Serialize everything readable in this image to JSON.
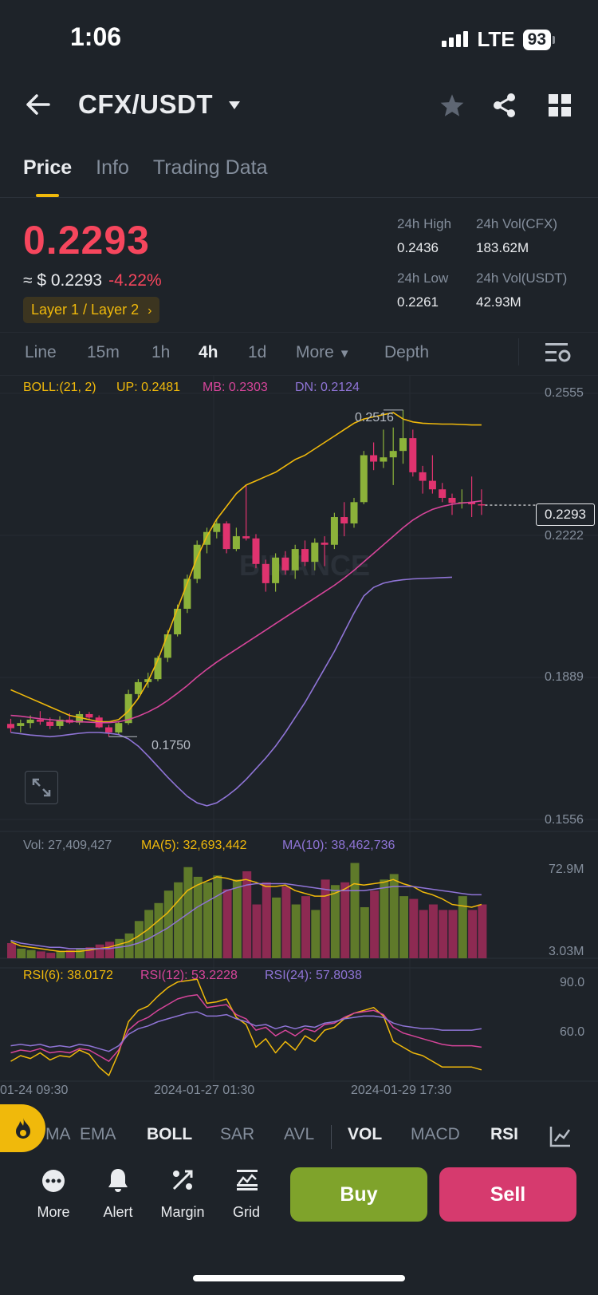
{
  "status_bar": {
    "time": "1:06",
    "network": "LTE",
    "battery": "93"
  },
  "header": {
    "pair": "CFX/USDT"
  },
  "tabs": [
    {
      "label": "Price",
      "active": true
    },
    {
      "label": "Info",
      "active": false
    },
    {
      "label": "Trading Data",
      "active": false
    }
  ],
  "price": {
    "last": "0.2293",
    "approx_usd": "≈ $ 0.2293",
    "change": "-4.22%",
    "tag": "Layer 1 / Layer 2"
  },
  "stats": {
    "high_label": "24h High",
    "high_value": "0.2436",
    "vol_cfx_label": "24h Vol(CFX)",
    "vol_cfx_value": "183.62M",
    "low_label": "24h Low",
    "low_value": "0.2261",
    "vol_usdt_label": "24h Vol(USDT)",
    "vol_usdt_value": "42.93M"
  },
  "intervals": [
    {
      "label": "Line"
    },
    {
      "label": "15m"
    },
    {
      "label": "1h"
    },
    {
      "label": "4h",
      "active": true
    },
    {
      "label": "1d"
    },
    {
      "label": "More"
    },
    {
      "label": "Depth"
    }
  ],
  "boll_legend": {
    "label": "BOLL:(21, 2)",
    "up": "UP: 0.2481",
    "mb": "MB: 0.2303",
    "dn": "DN: 0.2124"
  },
  "price_axis": [
    "0.2555",
    "0.2222",
    "0.1889",
    "0.1556"
  ],
  "current_price_tag": "0.2293",
  "high_marker": "0.2516",
  "low_marker": "0.1750",
  "watermark": "BINANCE",
  "vol_legend": {
    "vol": "Vol: 27,409,427",
    "ma5": "MA(5): 32,693,442",
    "ma10": "MA(10): 38,462,736"
  },
  "vol_axis": [
    "72.9M",
    "3.03M"
  ],
  "rsi_legend": {
    "rsi6": "RSI(6): 38.0172",
    "rsi12": "RSI(12): 53.2228",
    "rsi24": "RSI(24): 57.8038"
  },
  "rsi_axis": [
    "90.0",
    "60.0"
  ],
  "time_axis": [
    "01-24 09:30",
    "2024-01-27 01:30",
    "2024-01-29 17:30"
  ],
  "indicators": [
    {
      "label": "MA"
    },
    {
      "label": "EMA"
    },
    {
      "label": "BOLL",
      "active": true
    },
    {
      "label": "SAR"
    },
    {
      "label": "AVL"
    },
    {
      "label": "VOL",
      "active": true
    },
    {
      "label": "MACD"
    },
    {
      "label": "RSI",
      "active": true
    }
  ],
  "actions": [
    {
      "label": "More",
      "icon": "more-icon"
    },
    {
      "label": "Alert",
      "icon": "bell-icon"
    },
    {
      "label": "Margin",
      "icon": "margin-icon"
    },
    {
      "label": "Grid",
      "icon": "grid-bot-icon"
    }
  ],
  "buttons": {
    "buy": "Buy",
    "sell": "Sell"
  },
  "colors": {
    "up": "#8cb23a",
    "down": "#e0336f",
    "up_line": "#f0b90b",
    "mb_line": "#d6459a",
    "dn_line": "#8f74d6",
    "accent": "#f0b90b"
  },
  "chart_data": {
    "type": "candlestick",
    "interval": "4h",
    "price_range": [
      0.1556,
      0.2555
    ],
    "candles": [
      [
        0.178,
        0.1792,
        0.176,
        0.177
      ],
      [
        0.1775,
        0.179,
        0.176,
        0.1782
      ],
      [
        0.1782,
        0.18,
        0.177,
        0.179
      ],
      [
        0.179,
        0.181,
        0.1778,
        0.1785
      ],
      [
        0.1785,
        0.1795,
        0.1768,
        0.1775
      ],
      [
        0.1775,
        0.1798,
        0.1768,
        0.179
      ],
      [
        0.179,
        0.1805,
        0.178,
        0.1783
      ],
      [
        0.1783,
        0.181,
        0.1778,
        0.1803
      ],
      [
        0.1803,
        0.1808,
        0.179,
        0.1795
      ],
      [
        0.1795,
        0.18,
        0.177,
        0.1772
      ],
      [
        0.1772,
        0.1778,
        0.175,
        0.176
      ],
      [
        0.176,
        0.1785,
        0.1755,
        0.1782
      ],
      [
        0.1782,
        0.186,
        0.1778,
        0.185
      ],
      [
        0.185,
        0.1885,
        0.184,
        0.1878
      ],
      [
        0.1878,
        0.19,
        0.1865,
        0.1885
      ],
      [
        0.1885,
        0.194,
        0.188,
        0.1935
      ],
      [
        0.1935,
        0.2,
        0.1925,
        0.199
      ],
      [
        0.199,
        0.206,
        0.1985,
        0.205
      ],
      [
        0.205,
        0.213,
        0.204,
        0.212
      ],
      [
        0.212,
        0.221,
        0.211,
        0.22
      ],
      [
        0.22,
        0.224,
        0.218,
        0.223
      ],
      [
        0.223,
        0.226,
        0.2215,
        0.225
      ],
      [
        0.225,
        0.2255,
        0.218,
        0.219
      ],
      [
        0.219,
        0.224,
        0.2185,
        0.222
      ],
      [
        0.222,
        0.234,
        0.221,
        0.2215
      ],
      [
        0.2215,
        0.2225,
        0.2145,
        0.2155
      ],
      [
        0.2155,
        0.2165,
        0.209,
        0.211
      ],
      [
        0.211,
        0.218,
        0.209,
        0.217
      ],
      [
        0.217,
        0.2185,
        0.213,
        0.214
      ],
      [
        0.214,
        0.22,
        0.212,
        0.219
      ],
      [
        0.219,
        0.221,
        0.215,
        0.216
      ],
      [
        0.216,
        0.2215,
        0.214,
        0.2205
      ],
      [
        0.2205,
        0.222,
        0.215,
        0.22
      ],
      [
        0.22,
        0.2275,
        0.219,
        0.2265
      ],
      [
        0.2265,
        0.23,
        0.222,
        0.225
      ],
      [
        0.225,
        0.231,
        0.224,
        0.23
      ],
      [
        0.23,
        0.242,
        0.2295,
        0.241
      ],
      [
        0.241,
        0.244,
        0.2375,
        0.2395
      ],
      [
        0.2395,
        0.247,
        0.238,
        0.2405
      ],
      [
        0.2405,
        0.2475,
        0.234,
        0.242
      ],
      [
        0.242,
        0.2516,
        0.239,
        0.245
      ],
      [
        0.245,
        0.247,
        0.236,
        0.237
      ],
      [
        0.237,
        0.2385,
        0.232,
        0.235
      ],
      [
        0.235,
        0.241,
        0.232,
        0.233
      ],
      [
        0.233,
        0.2345,
        0.23,
        0.231
      ],
      [
        0.231,
        0.232,
        0.227,
        0.2298
      ],
      [
        0.2298,
        0.233,
        0.2285,
        0.23
      ],
      [
        0.23,
        0.236,
        0.2265,
        0.2295
      ],
      [
        0.2295,
        0.233,
        0.227,
        0.2293
      ]
    ],
    "boll_up": [
      0.186,
      0.185,
      0.184,
      0.183,
      0.182,
      0.181,
      0.18,
      0.1795,
      0.179,
      0.1785,
      0.1785,
      0.179,
      0.181,
      0.184,
      0.188,
      0.193,
      0.199,
      0.205,
      0.211,
      0.217,
      0.222,
      0.226,
      0.229,
      0.232,
      0.234,
      0.235,
      0.236,
      0.237,
      0.2385,
      0.24,
      0.241,
      0.2425,
      0.244,
      0.2455,
      0.247,
      0.2485,
      0.2495,
      0.25,
      0.2505,
      0.251,
      0.2495,
      0.2488,
      0.2485,
      0.2484,
      0.2483,
      0.2483,
      0.2482,
      0.2481,
      0.2481
    ],
    "boll_mb": [
      0.18,
      0.1798,
      0.1795,
      0.1792,
      0.179,
      0.1788,
      0.1786,
      0.1785,
      0.1784,
      0.1783,
      0.1783,
      0.1785,
      0.179,
      0.1798,
      0.1808,
      0.182,
      0.1835,
      0.1852,
      0.187,
      0.189,
      0.1908,
      0.1925,
      0.194,
      0.1955,
      0.197,
      0.1985,
      0.2,
      0.2015,
      0.203,
      0.2045,
      0.206,
      0.2075,
      0.209,
      0.2105,
      0.2122,
      0.214,
      0.216,
      0.218,
      0.22,
      0.222,
      0.224,
      0.2258,
      0.2272,
      0.2283,
      0.229,
      0.2295,
      0.2298,
      0.23,
      0.2303
    ],
    "boll_dn": [
      0.176,
      0.1757,
      0.1754,
      0.1752,
      0.175,
      0.1752,
      0.1755,
      0.1758,
      0.176,
      0.176,
      0.1758,
      0.1755,
      0.1745,
      0.1728,
      0.1705,
      0.168,
      0.1655,
      0.1632,
      0.161,
      0.1595,
      0.1588,
      0.1595,
      0.161,
      0.1628,
      0.165,
      0.1675,
      0.17,
      0.1728,
      0.176,
      0.1795,
      0.183,
      0.187,
      0.191,
      0.195,
      0.1995,
      0.204,
      0.208,
      0.21,
      0.211,
      0.2115,
      0.2118,
      0.212,
      0.2121,
      0.2122,
      0.2123,
      0.2124
    ],
    "volume_range": [
      3.03,
      72.9
    ],
    "volume_m": [
      14,
      10,
      9,
      8,
      7,
      8,
      9,
      10,
      11,
      13,
      15,
      17,
      21,
      30,
      38,
      43,
      52,
      58,
      69,
      62,
      58,
      63,
      53,
      60,
      66,
      42,
      58,
      47,
      55,
      42,
      48,
      38,
      60,
      56,
      58,
      72,
      40,
      52,
      60,
      64,
      48,
      46,
      38,
      42,
      38,
      38,
      48,
      38,
      42
    ],
    "vol_ma5": [
      15,
      12,
      11,
      10,
      9,
      8,
      8,
      8,
      9,
      10,
      11,
      13,
      15,
      19,
      24,
      30,
      36,
      44,
      52,
      56,
      59,
      62,
      61,
      59,
      60,
      58,
      55,
      55,
      56,
      52,
      50,
      48,
      48,
      50,
      53,
      57,
      56,
      57,
      58,
      60,
      57,
      55,
      51,
      49,
      46,
      42,
      41,
      40,
      42
    ],
    "vol_ma10": [
      16,
      14,
      13,
      12,
      11,
      11,
      10,
      10,
      10,
      10,
      10,
      11,
      12,
      14,
      17,
      21,
      25,
      30,
      35,
      40,
      44,
      48,
      52,
      54,
      56,
      57,
      57,
      57,
      57,
      56,
      55,
      54,
      53,
      52,
      52,
      52,
      52,
      53,
      54,
      55,
      55,
      55,
      54,
      53,
      52,
      51,
      50,
      49,
      49
    ],
    "rsi_range": [
      20,
      100
    ],
    "rsi6": [
      34,
      38,
      36,
      40,
      35,
      38,
      37,
      42,
      39,
      30,
      24,
      40,
      62,
      70,
      73,
      80,
      86,
      90,
      91,
      92,
      75,
      76,
      78,
      65,
      60,
      44,
      50,
      40,
      48,
      42,
      52,
      48,
      56,
      58,
      64,
      68,
      70,
      72,
      66,
      48,
      44,
      40,
      38,
      34,
      30,
      30,
      30,
      30,
      28
    ],
    "rsi12": [
      40,
      42,
      41,
      43,
      40,
      41,
      40,
      43,
      42,
      38,
      34,
      42,
      56,
      62,
      65,
      70,
      74,
      78,
      80,
      81,
      72,
      73,
      74,
      67,
      64,
      56,
      58,
      52,
      56,
      52,
      57,
      55,
      60,
      61,
      65,
      68,
      69,
      70,
      67,
      58,
      54,
      52,
      50,
      48,
      46,
      45,
      45,
      45,
      44
    ],
    "rsi24": [
      45,
      46,
      45,
      46,
      44,
      45,
      44,
      46,
      45,
      43,
      41,
      45,
      53,
      57,
      59,
      62,
      64,
      66,
      68,
      69,
      66,
      66,
      67,
      64,
      62,
      59,
      60,
      57,
      59,
      57,
      59,
      58,
      61,
      62,
      64,
      65,
      66,
      66,
      65,
      61,
      59,
      58,
      57,
      57,
      56,
      56,
      56,
      56,
      57
    ]
  }
}
